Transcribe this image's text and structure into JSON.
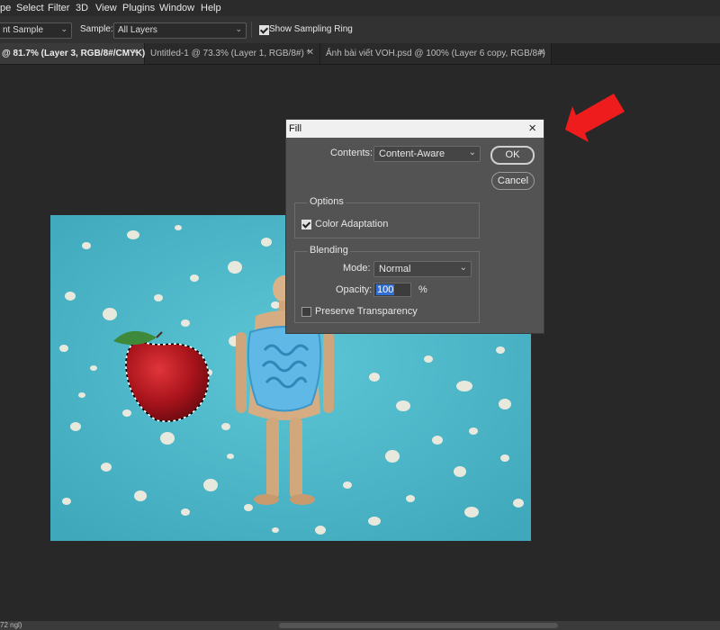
{
  "menubar": {
    "items": [
      "pe",
      "Select",
      "Filter",
      "3D",
      "View",
      "Plugins",
      "Window",
      "Help"
    ]
  },
  "options_bar": {
    "sample_size_value": "nt Sample",
    "sample_label": "Sample:",
    "sample_value": "All Layers",
    "show_sampling_ring_label": "Show Sampling Ring",
    "show_sampling_ring_checked": true
  },
  "tabs": [
    {
      "title": "@ 81.7% (Layer 3, RGB/8#/CMYK) *",
      "active": true
    },
    {
      "title": "Untitled-1 @ 73.3% (Layer 1, RGB/8#) *",
      "active": false
    },
    {
      "title": "Ảnh bài viết VOH.psd @ 100% (Layer 6 copy, RGB/8#)",
      "active": false
    }
  ],
  "fill_dialog": {
    "title": "Fill",
    "contents_label": "Contents:",
    "contents_value": "Content-Aware",
    "ok_label": "OK",
    "cancel_label": "Cancel",
    "options_heading": "Options",
    "color_adaptation_label": "Color Adaptation",
    "color_adaptation_checked": true,
    "blending_heading": "Blending",
    "mode_label": "Mode:",
    "mode_value": "Normal",
    "opacity_label": "Opacity:",
    "opacity_value": "100",
    "opacity_unit": "%",
    "preserve_transparency_label": "Preserve Transparency",
    "preserve_transparency_checked": false
  },
  "status": {
    "zoom_text": "72 ngl)"
  },
  "colors": {
    "canvas_background": "#4cb6c8",
    "workspace": "#282828",
    "dialog": "#535353",
    "arrow": "#ee1c1c",
    "selection_highlight": "#2f6fd3"
  }
}
